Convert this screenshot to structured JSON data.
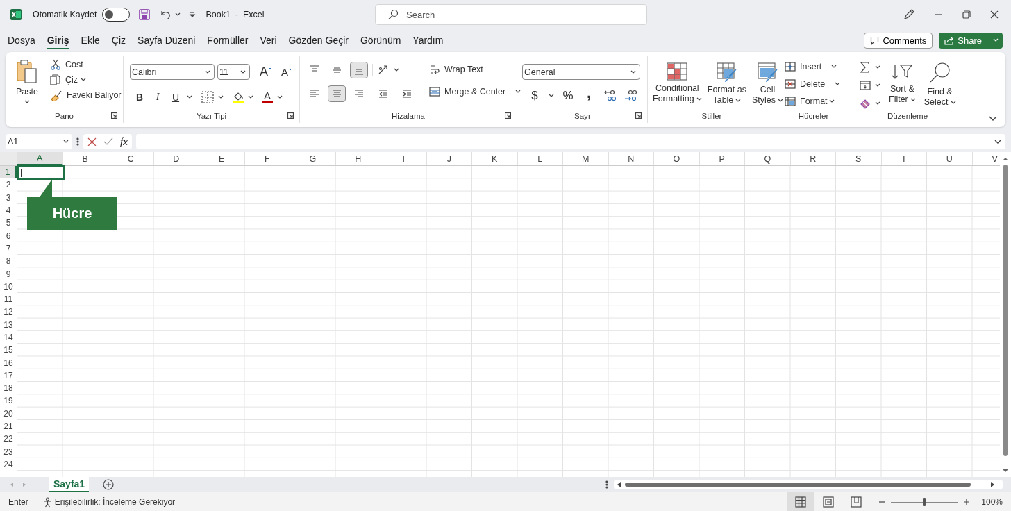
{
  "title_bar": {
    "autosave": {
      "label": "Otomatik Kaydet",
      "on": false
    },
    "document_title": "Book1  -  Excel",
    "search": {
      "placeholder": "Search"
    }
  },
  "menu_tabs": [
    {
      "label": "Dosya",
      "selected": false
    },
    {
      "label": "Giriş",
      "selected": true
    },
    {
      "label": "Ekle",
      "selected": false
    },
    {
      "label": "Çiz",
      "selected": false
    },
    {
      "label": "Sayfa Düzeni",
      "selected": false
    },
    {
      "label": "Formüller",
      "selected": false
    },
    {
      "label": "Veri",
      "selected": false
    },
    {
      "label": "Gözden Geçir",
      "selected": false
    },
    {
      "label": "Görünüm",
      "selected": false
    },
    {
      "label": "Yardım",
      "selected": false
    }
  ],
  "comments_button": {
    "label": "Comments"
  },
  "share_button": {
    "label": "Share"
  },
  "ribbon": {
    "groups": [
      {
        "kind": "clipboard",
        "label": "Pano",
        "launcher": true,
        "paste_label": "Paste",
        "commands": [
          "Cost",
          "Çiz",
          "Faveki Baliyor"
        ]
      },
      {
        "kind": "font",
        "label": "Yazı Tipi",
        "launcher": true,
        "font_name": "Calibri",
        "font_size": "11",
        "size_buttons": [
          "A",
          "A"
        ],
        "format_buttons": [
          "B",
          "I",
          "U"
        ],
        "fill_color": {
          "color": "#ffff00"
        },
        "font_color": {
          "glyph": "A",
          "color": "#c00000"
        }
      },
      {
        "kind": "alignment",
        "label": "Hizalama",
        "launcher": true,
        "vertical_align": [
          {
            "selected": false
          },
          {
            "selected": false
          },
          {
            "selected": true
          }
        ],
        "horizontal_align": [
          {
            "selected": false
          },
          {
            "selected": true
          },
          {
            "selected": false
          }
        ],
        "wrap_text": "Wrap Text",
        "merge_center": "Merge & Center"
      },
      {
        "kind": "number",
        "label": "Sayı",
        "launcher": true,
        "number_format": "General",
        "symbols": [
          "$",
          "%",
          ","
        ]
      },
      {
        "kind": "styles",
        "label": "Stiller",
        "launcher": false,
        "buttons": [
          "Conditional\nFormatting",
          "Format as\nTable",
          "Cell\nStyles"
        ]
      },
      {
        "kind": "cells",
        "label": "Hücreler",
        "launcher": false,
        "buttons": [
          "Insert",
          "Delete",
          "Format"
        ]
      },
      {
        "kind": "editing",
        "label": "Düzenleme",
        "launcher": false,
        "buttons": [
          "Sort &\nFilter",
          "Find &\nSelect"
        ]
      }
    ]
  },
  "formula_bar": {
    "name_box": "A1",
    "function_label": "fx"
  },
  "sheet": {
    "columns": [
      {
        "label": "A",
        "selected": true
      },
      {
        "label": "B",
        "selected": false
      },
      {
        "label": "C",
        "selected": false
      },
      {
        "label": "D",
        "selected": false
      },
      {
        "label": "E",
        "selected": false
      },
      {
        "label": "F",
        "selected": false
      },
      {
        "label": "G",
        "selected": false
      },
      {
        "label": "H",
        "selected": false
      },
      {
        "label": "I",
        "selected": false
      },
      {
        "label": "J",
        "selected": false
      },
      {
        "label": "K",
        "selected": false
      },
      {
        "label": "L",
        "selected": false
      },
      {
        "label": "M",
        "selected": false
      },
      {
        "label": "N",
        "selected": false
      },
      {
        "label": "O",
        "selected": false
      },
      {
        "label": "P",
        "selected": false
      },
      {
        "label": "Q",
        "selected": false
      },
      {
        "label": "R",
        "selected": false
      },
      {
        "label": "S",
        "selected": false
      },
      {
        "label": "T",
        "selected": false
      },
      {
        "label": "U",
        "selected": false
      },
      {
        "label": "V",
        "selected": false
      }
    ],
    "rows": [
      {
        "label": "1",
        "selected": true
      },
      {
        "label": "2",
        "selected": false
      },
      {
        "label": "3",
        "selected": false
      },
      {
        "label": "4",
        "selected": false
      },
      {
        "label": "5",
        "selected": false
      },
      {
        "label": "6",
        "selected": false
      },
      {
        "label": "7",
        "selected": false
      },
      {
        "label": "8",
        "selected": false
      },
      {
        "label": "9",
        "selected": false
      },
      {
        "label": "10",
        "selected": false
      },
      {
        "label": "11",
        "selected": false
      },
      {
        "label": "12",
        "selected": false
      },
      {
        "label": "13",
        "selected": false
      },
      {
        "label": "14",
        "selected": false
      },
      {
        "label": "15",
        "selected": false
      },
      {
        "label": "16",
        "selected": false
      },
      {
        "label": "17",
        "selected": false
      },
      {
        "label": "18",
        "selected": false
      },
      {
        "label": "19",
        "selected": false
      },
      {
        "label": "20",
        "selected": false
      },
      {
        "label": "21",
        "selected": false
      },
      {
        "label": "22",
        "selected": false
      },
      {
        "label": "23",
        "selected": false
      },
      {
        "label": "24",
        "selected": false
      }
    ],
    "callout": {
      "text": "Hücre"
    }
  },
  "sheet_tabs": [
    {
      "label": "Sayfa1",
      "selected": true
    }
  ],
  "status_bar": {
    "mode": "Enter",
    "accessibility": "Erişilebilirlik: İnceleme Gerekiyor",
    "views": [
      {
        "kind": "normal",
        "selected": true
      },
      {
        "kind": "page_layout",
        "selected": false
      },
      {
        "kind": "page_break",
        "selected": false
      }
    ],
    "zoom": {
      "level": 0.5,
      "reading": "100%"
    }
  }
}
